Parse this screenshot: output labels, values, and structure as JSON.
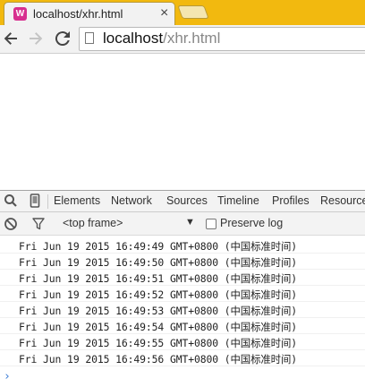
{
  "browser": {
    "tab_title": "localhost/xhr.html",
    "tab_close": "×",
    "favicon_label": "W",
    "url_host": "localhost",
    "url_path": "/xhr.html"
  },
  "devtools": {
    "tabs": [
      "Elements",
      "Network",
      "Sources",
      "Timeline",
      "Profiles",
      "Resources"
    ],
    "frame_select": "<top frame>",
    "preserve_log_label": "Preserve log",
    "console_lines": [
      "Fri Jun 19 2015 16:49:49 GMT+0800 (中国标准时间)",
      "Fri Jun 19 2015 16:49:50 GMT+0800 (中国标准时间)",
      "Fri Jun 19 2015 16:49:51 GMT+0800 (中国标准时间)",
      "Fri Jun 19 2015 16:49:52 GMT+0800 (中国标准时间)",
      "Fri Jun 19 2015 16:49:53 GMT+0800 (中国标准时间)",
      "Fri Jun 19 2015 16:49:54 GMT+0800 (中国标准时间)",
      "Fri Jun 19 2015 16:49:55 GMT+0800 (中国标准时间)",
      "Fri Jun 19 2015 16:49:56 GMT+0800 (中国标准时间)"
    ],
    "prompt_symbol": "›"
  },
  "icons": {
    "back": "arrow-left-icon",
    "forward": "arrow-right-icon",
    "reload": "reload-icon",
    "inspect": "search-icon",
    "device": "device-mode-icon",
    "clear": "clear-console-icon",
    "filter": "filter-icon"
  }
}
